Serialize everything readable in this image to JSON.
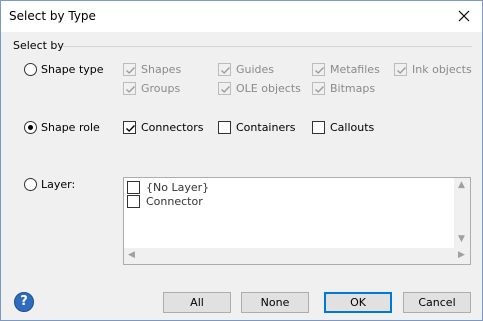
{
  "window": {
    "title": "Select by Type"
  },
  "group": {
    "label": "Select by"
  },
  "options": {
    "shape_type": {
      "label": "Shape type",
      "selected": false
    },
    "shape_role": {
      "label": "Shape role",
      "selected": true
    },
    "layer": {
      "label": "Layer:",
      "selected": false
    }
  },
  "shape_type_checks": [
    {
      "label": "Shapes",
      "checked": true,
      "enabled": false
    },
    {
      "label": "Guides",
      "checked": true,
      "enabled": false
    },
    {
      "label": "Metafiles",
      "checked": true,
      "enabled": false
    },
    {
      "label": "Ink objects",
      "checked": true,
      "enabled": false
    },
    {
      "label": "Groups",
      "checked": true,
      "enabled": false
    },
    {
      "label": "OLE objects",
      "checked": true,
      "enabled": false
    },
    {
      "label": "Bitmaps",
      "checked": true,
      "enabled": false
    }
  ],
  "shape_role_checks": [
    {
      "label": "Connectors",
      "checked": true
    },
    {
      "label": "Containers",
      "checked": false
    },
    {
      "label": "Callouts",
      "checked": false
    }
  ],
  "layers": [
    {
      "label": "{No Layer}",
      "checked": false
    },
    {
      "label": "Connector",
      "checked": false
    }
  ],
  "buttons": {
    "all": "All",
    "none": "None",
    "ok": "OK",
    "cancel": "Cancel"
  },
  "help": {
    "glyph": "?"
  },
  "icons": {
    "close": "close-icon",
    "help": "help-icon"
  }
}
